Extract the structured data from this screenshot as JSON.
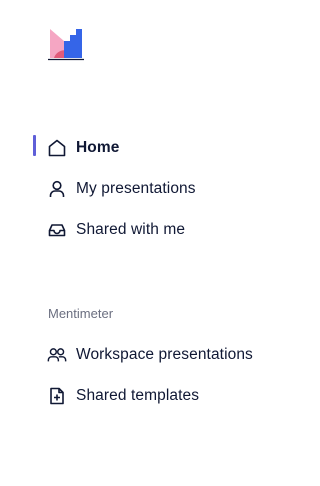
{
  "brand": {
    "logo_icon": "mentimeter-logo-icon",
    "colors": [
      "#f5a6c3",
      "#e25b7b",
      "#3565e8"
    ]
  },
  "nav": {
    "accent": "#5f5fd8",
    "items": [
      {
        "label": "Home",
        "icon": "home-icon",
        "active": true
      },
      {
        "label": "My presentations",
        "icon": "user-icon",
        "active": false
      },
      {
        "label": "Shared with me",
        "icon": "inbox-icon",
        "active": false
      }
    ]
  },
  "workspace": {
    "heading": "Mentimeter",
    "items": [
      {
        "label": "Workspace presentations",
        "icon": "users-icon"
      },
      {
        "label": "Shared templates",
        "icon": "file-plus-icon"
      }
    ]
  }
}
